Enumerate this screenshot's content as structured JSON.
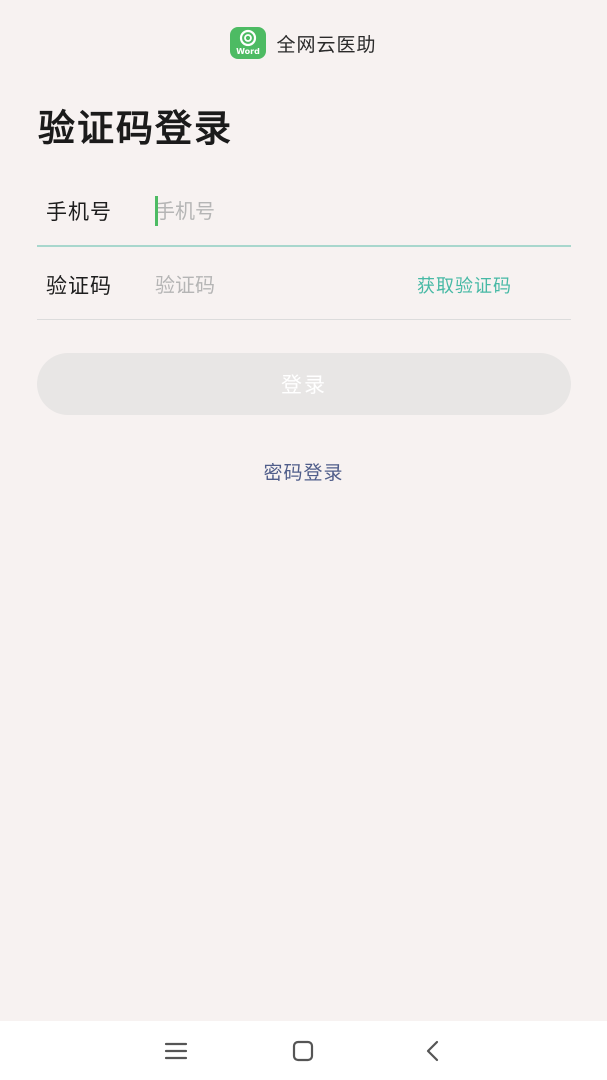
{
  "header": {
    "app_name": "全网云医助",
    "logo_text": "Word",
    "logo_icon": "app-logo-icon"
  },
  "title": "验证码登录",
  "form": {
    "phone_label": "手机号",
    "phone_placeholder": "手机号",
    "phone_value": "",
    "code_label": "验证码",
    "code_placeholder": "验证码",
    "code_value": "",
    "get_code_label": "获取验证码"
  },
  "login_button_label": "登录",
  "password_login_label": "密码登录",
  "nav": {
    "menu_icon": "menu-icon",
    "home_icon": "home-icon",
    "back_icon": "back-icon"
  },
  "colors": {
    "accent_green": "#4dbb63",
    "link_teal": "#47b9a5",
    "link_blue": "#4f5d8a",
    "background": "#f7f2f1",
    "disabled_button": "#e8e6e5"
  }
}
